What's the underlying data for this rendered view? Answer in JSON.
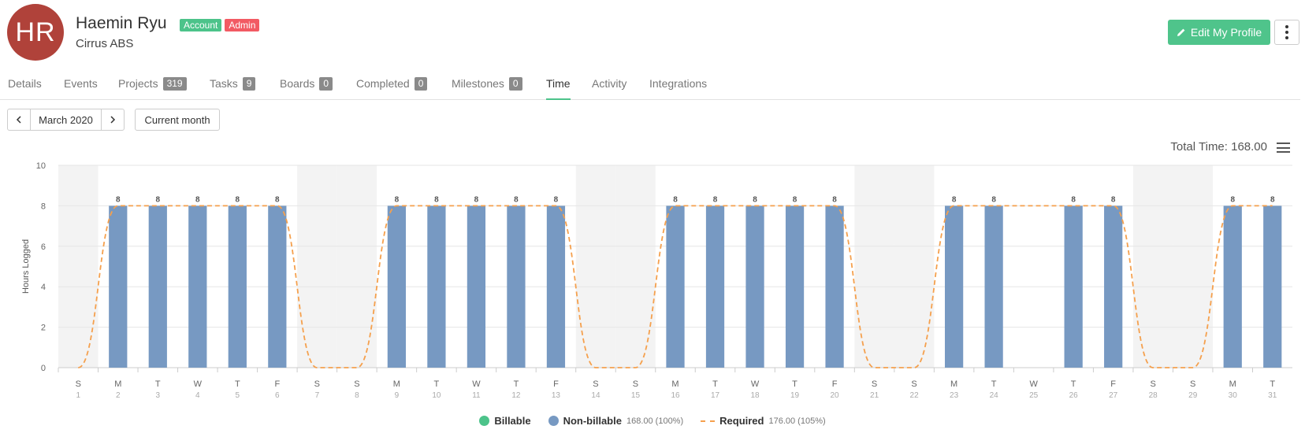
{
  "user": {
    "initials": "HR",
    "name": "Haemin Ryu",
    "company": "Cirrus ABS",
    "badges": [
      "Account",
      "Admin"
    ]
  },
  "actions": {
    "edit_label": "Edit My Profile",
    "edit_icon": "pencil-icon",
    "more_icon": "vertical-dots-icon"
  },
  "tabs": [
    {
      "label": "Details",
      "count": null,
      "active": false
    },
    {
      "label": "Events",
      "count": null,
      "active": false
    },
    {
      "label": "Projects",
      "count": "319",
      "active": false
    },
    {
      "label": "Tasks",
      "count": "9",
      "active": false
    },
    {
      "label": "Boards",
      "count": "0",
      "active": false
    },
    {
      "label": "Completed",
      "count": "0",
      "active": false
    },
    {
      "label": "Milestones",
      "count": "0",
      "active": false
    },
    {
      "label": "Time",
      "count": null,
      "active": true
    },
    {
      "label": "Activity",
      "count": null,
      "active": false
    },
    {
      "label": "Integrations",
      "count": null,
      "active": false
    }
  ],
  "period": {
    "prev_icon": "chevron-left-icon",
    "next_icon": "chevron-right-icon",
    "month_label": "March 2020",
    "current_label": "Current month"
  },
  "total_time_label": "Total Time: 168.00",
  "colors": {
    "billable": "#4cc38a",
    "non_billable": "#7799c2",
    "required": "#f5a04d",
    "weekend_band": "#f3f3f3"
  },
  "chart_data": {
    "type": "bar",
    "title": "",
    "xlabel": "",
    "ylabel": "Hours Logged",
    "ylim": [
      0,
      10
    ],
    "yticks": [
      0,
      2,
      4,
      6,
      8,
      10
    ],
    "grid": true,
    "legend_position": "bottom",
    "day_letters": [
      "S",
      "M",
      "T",
      "W",
      "T",
      "F",
      "S",
      "S",
      "M",
      "T",
      "W",
      "T",
      "F",
      "S",
      "S",
      "M",
      "T",
      "W",
      "T",
      "F",
      "S",
      "S",
      "M",
      "T",
      "W",
      "T",
      "F",
      "S",
      "S",
      "M",
      "T"
    ],
    "categories": [
      "1",
      "2",
      "3",
      "4",
      "5",
      "6",
      "7",
      "8",
      "9",
      "10",
      "11",
      "12",
      "13",
      "14",
      "15",
      "16",
      "17",
      "18",
      "19",
      "20",
      "21",
      "22",
      "23",
      "24",
      "25",
      "26",
      "27",
      "28",
      "29",
      "30",
      "31"
    ],
    "weekend": [
      true,
      false,
      false,
      false,
      false,
      false,
      true,
      true,
      false,
      false,
      false,
      false,
      false,
      true,
      true,
      false,
      false,
      false,
      false,
      false,
      true,
      true,
      false,
      false,
      false,
      false,
      false,
      true,
      true,
      false,
      false
    ],
    "series": [
      {
        "name": "Billable",
        "type": "bar",
        "values": [
          0,
          0,
          0,
          0,
          0,
          0,
          0,
          0,
          0,
          0,
          0,
          0,
          0,
          0,
          0,
          0,
          0,
          0,
          0,
          0,
          0,
          0,
          0,
          0,
          0,
          0,
          0,
          0,
          0,
          0,
          0
        ]
      },
      {
        "name": "Non-billable",
        "type": "bar",
        "values": [
          0,
          8,
          8,
          8,
          8,
          8,
          0,
          0,
          8,
          8,
          8,
          8,
          8,
          0,
          0,
          8,
          8,
          8,
          8,
          8,
          0,
          0,
          8,
          8,
          0,
          8,
          8,
          0,
          0,
          8,
          8
        ]
      },
      {
        "name": "Required",
        "type": "line",
        "values": [
          0,
          8,
          8,
          8,
          8,
          8,
          0,
          0,
          8,
          8,
          8,
          8,
          8,
          0,
          0,
          8,
          8,
          8,
          8,
          8,
          0,
          0,
          8,
          8,
          8,
          8,
          8,
          0,
          0,
          8,
          8
        ]
      }
    ],
    "legend": [
      {
        "name": "Billable",
        "detail": ""
      },
      {
        "name": "Non-billable",
        "detail": "168.00 (100%)"
      },
      {
        "name": "Required",
        "detail": "176.00 (105%)"
      }
    ]
  }
}
